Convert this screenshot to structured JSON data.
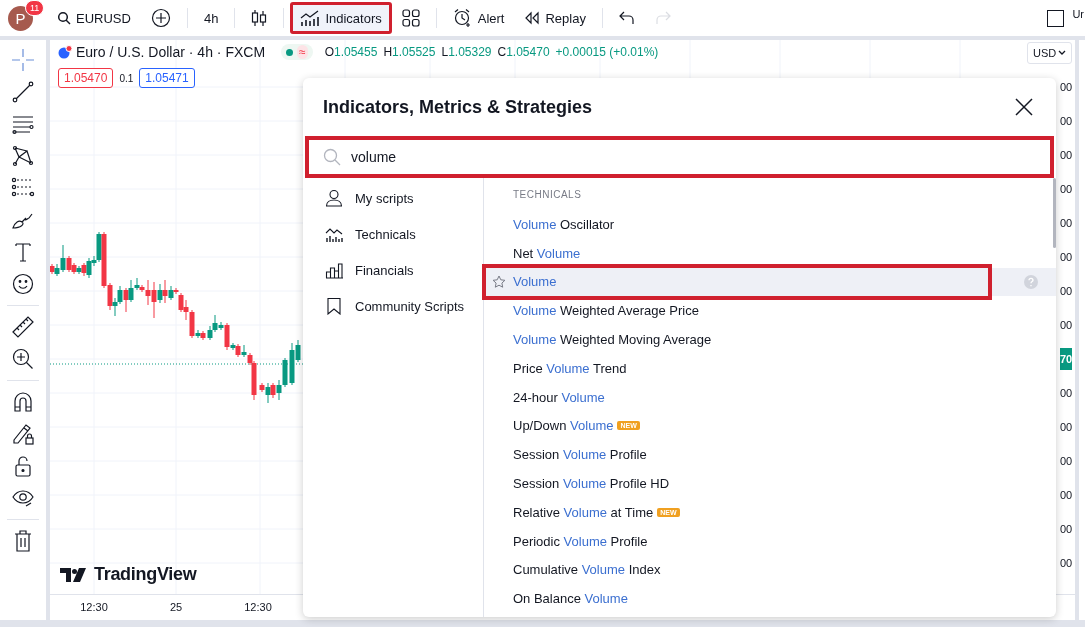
{
  "toolbar": {
    "avatar": {
      "letter": "P",
      "badge": "11"
    },
    "groups": [
      [
        {
          "kind": "symbol",
          "label": "EURUSD",
          "highlighted": false,
          "disabled": false
        },
        {
          "kind": "add",
          "highlighted": false,
          "disabled": false
        }
      ],
      [
        {
          "kind": "interval",
          "label": "4h",
          "highlighted": false,
          "disabled": false
        }
      ],
      [
        {
          "kind": "chart-type",
          "highlighted": false,
          "disabled": false
        }
      ],
      [
        {
          "kind": "indicators",
          "label": "Indicators",
          "highlighted": true,
          "disabled": false
        },
        {
          "kind": "layouts",
          "highlighted": false,
          "disabled": false
        }
      ],
      [
        {
          "kind": "alert",
          "label": "Alert",
          "highlighted": false,
          "disabled": false
        },
        {
          "kind": "replay",
          "label": "Replay",
          "highlighted": false,
          "disabled": false
        }
      ],
      [
        {
          "kind": "undo",
          "highlighted": false,
          "disabled": false
        },
        {
          "kind": "redo",
          "highlighted": false,
          "disabled": true
        }
      ]
    ],
    "right_label": "Ur"
  },
  "tool_groups": [
    [
      {
        "kind": "crosshair",
        "selected": true
      },
      {
        "kind": "trend-line",
        "selected": false
      },
      {
        "kind": "parallel",
        "selected": false
      },
      {
        "kind": "pattern",
        "selected": false
      },
      {
        "kind": "fib",
        "selected": false
      },
      {
        "kind": "brush",
        "selected": false
      },
      {
        "kind": "text",
        "selected": false
      },
      {
        "kind": "emoji",
        "selected": false
      }
    ],
    [
      {
        "kind": "ruler",
        "selected": false
      },
      {
        "kind": "zoom",
        "selected": false
      }
    ],
    [
      {
        "kind": "magnet",
        "selected": false
      },
      {
        "kind": "pencil-lock",
        "selected": false
      },
      {
        "kind": "lock",
        "selected": false
      },
      {
        "kind": "eye",
        "selected": false
      }
    ],
    [
      {
        "kind": "trash",
        "selected": false
      }
    ]
  ],
  "chart": {
    "legend": {
      "title": "Euro / U.S. Dollar · 4h · FXCM",
      "status_mark": "≈",
      "ohlc": [
        {
          "label": "O",
          "value": "1.05455"
        },
        {
          "label": "H",
          "value": "1.05525"
        },
        {
          "label": "L",
          "value": "1.05329"
        },
        {
          "label": "C",
          "value": "1.05470"
        }
      ],
      "change": "+0.00015 (+0.01%)",
      "sell": "1.05470",
      "spread": "0.1",
      "buy": "1.05471"
    },
    "currency": "USD",
    "price_labels": [
      {
        "text": "00",
        "kind": "tick"
      },
      {
        "text": "00",
        "kind": "tick"
      },
      {
        "text": "00",
        "kind": "tick"
      },
      {
        "text": "00",
        "kind": "tick"
      },
      {
        "text": "00",
        "kind": "tick"
      },
      {
        "text": "00",
        "kind": "tick"
      },
      {
        "text": "00",
        "kind": "tick"
      },
      {
        "text": "00",
        "kind": "tick"
      },
      {
        "text": "70",
        "kind": "last"
      },
      {
        "text": "00",
        "kind": "tick"
      },
      {
        "text": "00",
        "kind": "tick"
      },
      {
        "text": "00",
        "kind": "tick"
      },
      {
        "text": "00",
        "kind": "tick"
      },
      {
        "text": "00",
        "kind": "tick"
      },
      {
        "text": "00",
        "kind": "tick"
      }
    ],
    "time_labels": [
      "12:30",
      "25",
      "12:30"
    ],
    "logo": "TradingView"
  },
  "dialog": {
    "title": "Indicators, Metrics & Strategies",
    "search": {
      "value": "volume",
      "highlighted": true
    },
    "categories": [
      {
        "kind": "person",
        "label": "My scripts"
      },
      {
        "kind": "technicals",
        "label": "Technicals"
      },
      {
        "kind": "financials",
        "label": "Financials"
      },
      {
        "kind": "bookmark",
        "label": "Community Scripts"
      }
    ],
    "section": "TECHNICALS",
    "results": [
      {
        "parts": [
          {
            "text": "Volume",
            "match": true
          },
          {
            "text": " Oscillator",
            "match": false
          }
        ],
        "selected": false,
        "highlighted": false
      },
      {
        "parts": [
          {
            "text": "Net ",
            "match": false
          },
          {
            "text": "Volume",
            "match": true
          }
        ],
        "selected": false,
        "highlighted": false
      },
      {
        "parts": [
          {
            "text": "Volume",
            "match": true
          }
        ],
        "selected": true,
        "highlighted": true
      },
      {
        "parts": [
          {
            "text": "Volume",
            "match": true
          },
          {
            "text": " Weighted Average Price",
            "match": false
          }
        ],
        "selected": false,
        "highlighted": false
      },
      {
        "parts": [
          {
            "text": "Volume",
            "match": true
          },
          {
            "text": " Weighted Moving Average",
            "match": false
          }
        ],
        "selected": false,
        "highlighted": false
      },
      {
        "parts": [
          {
            "text": "Price ",
            "match": false
          },
          {
            "text": "Volume",
            "match": true
          },
          {
            "text": " Trend",
            "match": false
          }
        ],
        "selected": false,
        "highlighted": false
      },
      {
        "parts": [
          {
            "text": "24-hour ",
            "match": false
          },
          {
            "text": "Volume",
            "match": true
          }
        ],
        "selected": false,
        "highlighted": false
      },
      {
        "parts": [
          {
            "text": "Up/Down ",
            "match": false
          },
          {
            "text": "Volume",
            "match": true
          }
        ],
        "badge": "NEW",
        "selected": false,
        "highlighted": false
      },
      {
        "parts": [
          {
            "text": "Session ",
            "match": false
          },
          {
            "text": "Volume",
            "match": true
          },
          {
            "text": " Profile",
            "match": false
          }
        ],
        "selected": false,
        "highlighted": false
      },
      {
        "parts": [
          {
            "text": "Session ",
            "match": false
          },
          {
            "text": "Volume",
            "match": true
          },
          {
            "text": " Profile HD",
            "match": false
          }
        ],
        "selected": false,
        "highlighted": false
      },
      {
        "parts": [
          {
            "text": "Relative ",
            "match": false
          },
          {
            "text": "Volume",
            "match": true
          },
          {
            "text": " at Time",
            "match": false
          }
        ],
        "badge": "NEW",
        "selected": false,
        "highlighted": false
      },
      {
        "parts": [
          {
            "text": "Periodic ",
            "match": false
          },
          {
            "text": "Volume",
            "match": true
          },
          {
            "text": " Profile",
            "match": false
          }
        ],
        "selected": false,
        "highlighted": false
      },
      {
        "parts": [
          {
            "text": "Cumulative ",
            "match": false
          },
          {
            "text": "Volume",
            "match": true
          },
          {
            "text": " Index",
            "match": false
          }
        ],
        "selected": false,
        "highlighted": false
      },
      {
        "parts": [
          {
            "text": "On Balance ",
            "match": false
          },
          {
            "text": "Volume",
            "match": true
          }
        ],
        "selected": false,
        "highlighted": false
      }
    ]
  }
}
